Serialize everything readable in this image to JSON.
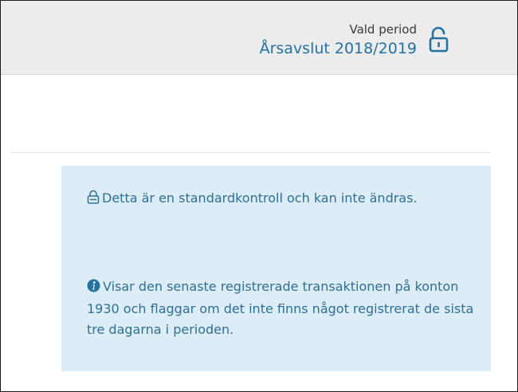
{
  "header": {
    "period_label": "Vald period",
    "period_value": "Årsavslut 2018/2019",
    "lock_icon": "unlocked-padlock-icon"
  },
  "notice": {
    "standard_control_text": "Detta är en standardkontroll och kan inte ändras.",
    "description_text": "Visar den senaste registrerade transaktionen på konton 1930 och flaggar om det inte finns något registrerat de sista tre dagarna i perioden.",
    "lock_icon": "lock-icon",
    "info_icon": "info-icon"
  },
  "colors": {
    "accent": "#2472a4",
    "info_bg": "#dcedf7",
    "info_text": "#2f6f98",
    "topbar_bg": "#ececec"
  }
}
